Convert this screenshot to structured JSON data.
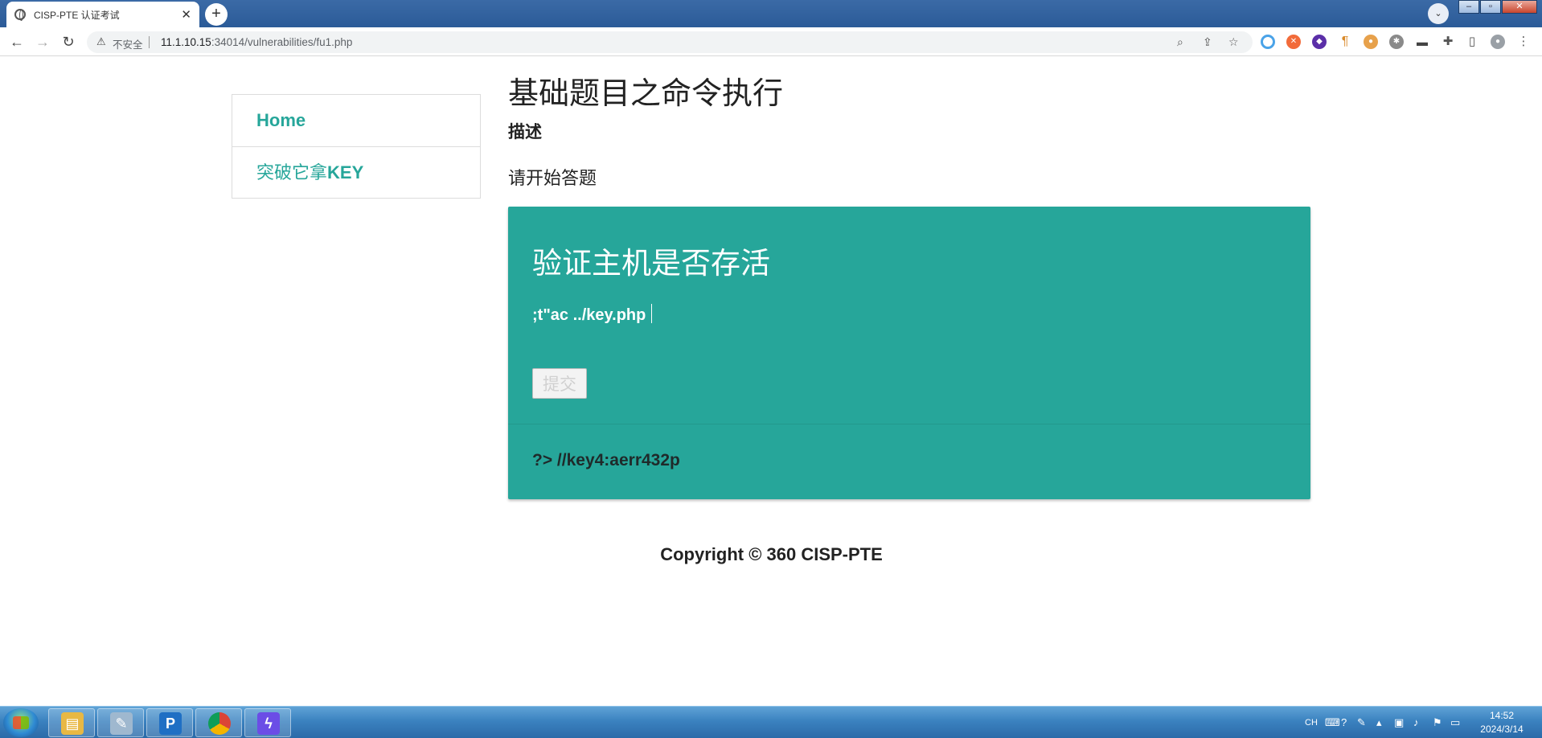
{
  "browser": {
    "tab_title": "CISP-PTE 认证考试",
    "tab_close": "✕",
    "new_tab": "+",
    "tab_search": "⌄",
    "security_label": "不安全",
    "url_host": "11.1.10.15",
    "url_rest": ":34014/vulnerabilities/fu1.php",
    "back": "←",
    "forward": "→",
    "reload": "↻"
  },
  "sidebar": {
    "items": [
      {
        "label": "Home"
      },
      {
        "label_cn": "突破它拿",
        "label_en": "KEY"
      }
    ]
  },
  "main": {
    "title": "基础题目之命令执行",
    "desc_label": "描述",
    "desc_text": "请开始答题"
  },
  "card": {
    "title": "验证主机是否存活",
    "input_value": ";t\"ac ../key.php",
    "submit_label": "提交",
    "result_text": "?> //key4:aerr432p"
  },
  "footer": {
    "copyright": "Copyright © 360 CISP-PTE"
  },
  "taskbar": {
    "lang": "CH",
    "time": "14:52",
    "date": "2024/3/14"
  },
  "colors": {
    "accent": "#26a69a",
    "titlebar": "#2b5b98"
  }
}
